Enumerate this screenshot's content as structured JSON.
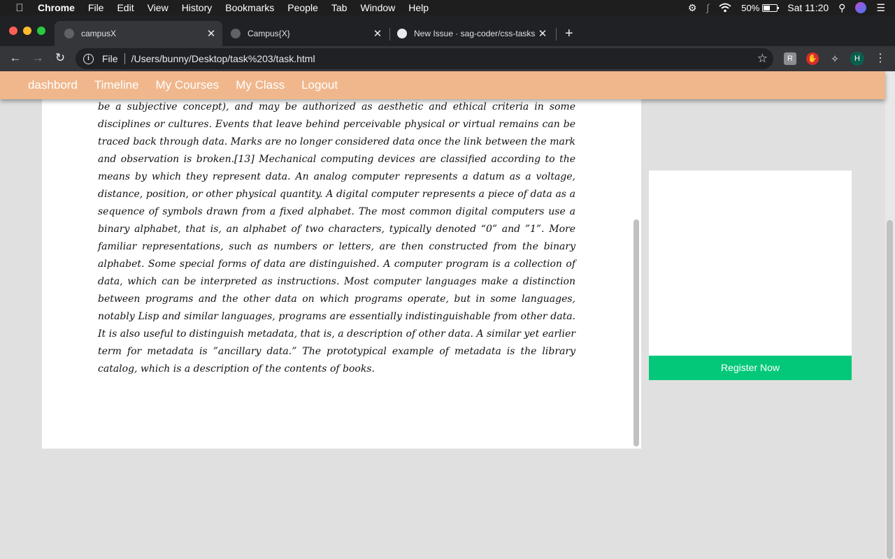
{
  "menubar": {
    "items": [
      "Chrome",
      "File",
      "Edit",
      "View",
      "History",
      "Bookmarks",
      "People",
      "Tab",
      "Window",
      "Help"
    ],
    "battery": "50%",
    "clock": "Sat 11:20"
  },
  "tabs": [
    {
      "title": "campusX"
    },
    {
      "title": "Campus{X}"
    },
    {
      "title": "New Issue · sag-coder/css-tasks"
    }
  ],
  "toolbar": {
    "scheme": "File",
    "url": "/Users/bunny/Desktop/task%203/task.html",
    "profile_initial": "H"
  },
  "nav": {
    "links": [
      "dashbord",
      "Timeline",
      "My Courses",
      "My Class",
      "Logout"
    ]
  },
  "article": {
    "text": "be a subjective concept), and may be authorized as aesthetic and ethical criteria in some disciplines or cultures. Events that leave behind perceivable physical or virtual remains can be traced back through data. Marks are no longer considered data once the link between the mark and observation is broken.[13] Mechanical computing devices are classified according to the means by which they represent data. An analog computer represents a datum as a voltage, distance, position, or other physical quantity. A digital computer represents a piece of data as a sequence of symbols drawn from a fixed alphabet. The most common digital computers use a binary alphabet, that is, an alphabet of two characters, typically denoted “0” and ”1”. More familiar representations, such as numbers or letters, are then constructed from the binary alphabet. Some special forms of data are distinguished. A computer program is a collection of data, which can be interpreted as instructions. Most computer languages make a distinction between programs and the other data on which programs operate, but in some languages, notably Lisp and similar languages, programs are essentially indistinguishable from other data. It is also useful to distinguish metadata, that is, a description of other data. A similar yet earlier term for metadata is ”ancillary data.” The prototypical example of metadata is the library catalog, which is a description of the contents of books."
  },
  "sidebar": {
    "register_label": "Register Now"
  },
  "colors": {
    "nav_bg": "#f0b78c",
    "register_bg": "#03c879",
    "page_bg": "#e0e0e0"
  }
}
